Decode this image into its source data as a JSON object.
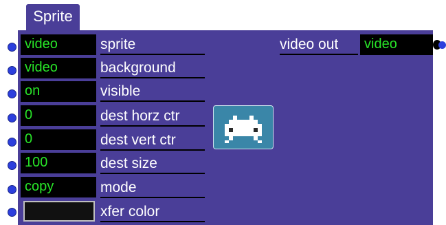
{
  "tab": {
    "title": "Sprite"
  },
  "inputs": [
    {
      "value": "video",
      "label": "sprite"
    },
    {
      "value": "video",
      "label": "background"
    },
    {
      "value": "on",
      "label": "visible"
    },
    {
      "value": "0",
      "label": "dest horz ctr"
    },
    {
      "value": "0",
      "label": "dest vert ctr"
    },
    {
      "value": "100",
      "label": "dest size"
    },
    {
      "value": "copy",
      "label": "mode"
    },
    {
      "value": "",
      "label": "xfer color"
    }
  ],
  "output": {
    "label": "video out",
    "value": "video"
  },
  "thumbnail_icon": "space-invader-icon",
  "colors": {
    "panel": "#4a3e98",
    "value_text": "#28e628",
    "port_dot": "#2c3fdd",
    "thumbnail": "#3a86a8"
  }
}
